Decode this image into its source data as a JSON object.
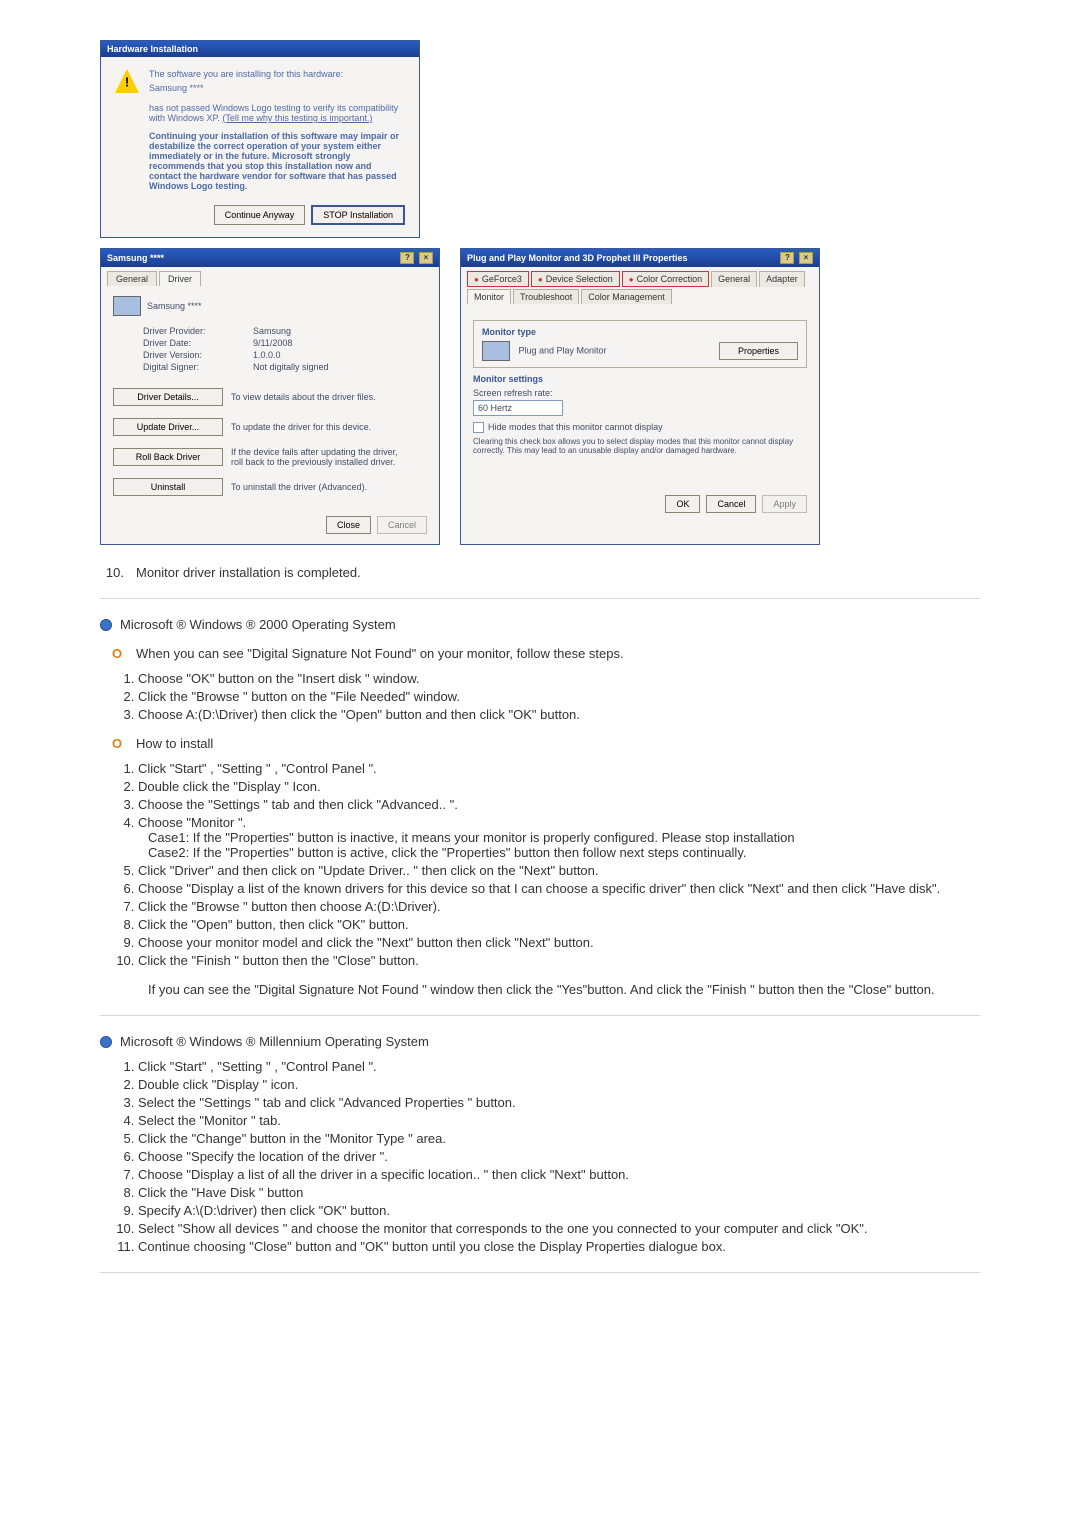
{
  "hw_install": {
    "title": "Hardware Installation",
    "line1": "The software you are installing for this hardware:",
    "device": "Samsung ****",
    "line2a": "has not passed Windows Logo testing to verify its compatibility with Windows XP. ",
    "link": "(Tell me why this testing is important.)",
    "warn": "Continuing your installation of this software may impair or destabilize the correct operation of your system either immediately or in the future. Microsoft strongly recommends that you stop this installation now and contact the hardware vendor for software that has passed Windows Logo testing.",
    "btn_continue": "Continue Anyway",
    "btn_stop": "STOP Installation"
  },
  "samsung_props": {
    "title": "Samsung **** ",
    "tab_general": "General",
    "tab_driver": "Driver",
    "device": "Samsung ****",
    "rows": {
      "provider_k": "Driver Provider:",
      "provider_v": "Samsung",
      "date_k": "Driver Date:",
      "date_v": "9/11/2008",
      "version_k": "Driver Version:",
      "version_v": "1.0.0.0",
      "signer_k": "Digital Signer:",
      "signer_v": "Not digitally signed"
    },
    "btns": {
      "details": "Driver Details...",
      "details_d": "To view details about the driver files.",
      "update": "Update Driver...",
      "update_d": "To update the driver for this device.",
      "rollback": "Roll Back Driver",
      "rollback_d": "If the device fails after updating the driver, roll back to the previously installed driver.",
      "uninstall": "Uninstall",
      "uninstall_d": "To uninstall the driver (Advanced)."
    },
    "close": "Close",
    "cancel": "Cancel"
  },
  "pnp": {
    "title": "Plug and Play Monitor and 3D Prophet III Properties",
    "tabs": {
      "geforce": "GeForce3",
      "device": "Device Selection",
      "color_corr": "Color Correction",
      "general": "General",
      "adapter": "Adapter",
      "monitor": "Monitor",
      "trouble": "Troubleshoot",
      "color_mgmt": "Color Management"
    },
    "monitor_type_lbl": "Monitor type",
    "monitor_type_val": "Plug and Play Monitor",
    "btn_properties": "Properties",
    "monitor_settings_lbl": "Monitor settings",
    "refresh_lbl": "Screen refresh rate:",
    "refresh_val": "60 Hertz",
    "hide_chk": "Hide modes that this monitor cannot display",
    "hide_desc": "Clearing this check box allows you to select display modes that this monitor cannot display correctly. This may lead to an unusable display and/or damaged hardware.",
    "ok": "OK",
    "cancel": "Cancel",
    "apply": "Apply"
  },
  "step10": {
    "num": "10.",
    "text": "Monitor driver installation is completed."
  },
  "win2000": {
    "title": "Microsoft ®  Windows ®  2000 Operating System",
    "dsig_line": "When you can see \"Digital Signature Not Found\" on your monitor, follow these steps.",
    "dsig_steps": [
      "Choose \"OK\" button on the \"Insert disk \" window.",
      "Click the \"Browse \" button on the \"File Needed\" window.",
      "Choose A:(D:\\Driver) then click the \"Open\" button and then click \"OK\" button."
    ],
    "howto": "How to install",
    "install_steps": [
      "Click \"Start\" , \"Setting \" , \"Control Panel \".",
      "Double click the \"Display \" Icon.",
      "Choose the \"Settings \" tab and then click \"Advanced.. \".",
      "Choose \"Monitor \".",
      "Click \"Driver\" and then click on \"Update Driver.. \" then click on the \"Next\" button.",
      "Choose \"Display a list of the known drivers for this device so that I can choose a specific driver\" then click \"Next\" and then click \"Have disk\".",
      "Click the \"Browse \" button then choose A:(D:\\Driver).",
      "Click the \"Open\" button, then click \"OK\" button.",
      "Choose your monitor model and click the \"Next\" button then click \"Next\" button.",
      "Click the \"Finish \" button then the \"Close\" button."
    ],
    "case1": "Case1: If the \"Properties\" button is inactive, it means your monitor is properly configured. Please stop installation",
    "case2": "Case2: If the \"Properties\" button is active, click the \"Properties\" button then follow next steps continually.",
    "post_note": "If you can see the \"Digital Signature Not Found \" window then click the \"Yes\"button. And click the \"Finish \" button then the \"Close\" button."
  },
  "winme": {
    "title": "Microsoft ®  Windows ®  Millennium Operating System",
    "steps": [
      "Click \"Start\" , \"Setting \" , \"Control Panel \".",
      "Double click \"Display \" icon.",
      "Select the \"Settings \" tab and click \"Advanced Properties \" button.",
      "Select the \"Monitor \" tab.",
      "Click the \"Change\" button in the \"Monitor Type \" area.",
      "Choose \"Specify the location of the driver \".",
      "Choose \"Display a list of all the driver in a specific location.. \" then click \"Next\" button.",
      "Click the \"Have Disk \" button",
      "Specify A:\\(D:\\driver) then click \"OK\" button.",
      "Select \"Show all devices \" and choose the monitor that corresponds to the one you connected to your computer and click \"OK\".",
      "Continue choosing \"Close\" button and \"OK\" button until you close the Display Properties dialogue box."
    ]
  }
}
